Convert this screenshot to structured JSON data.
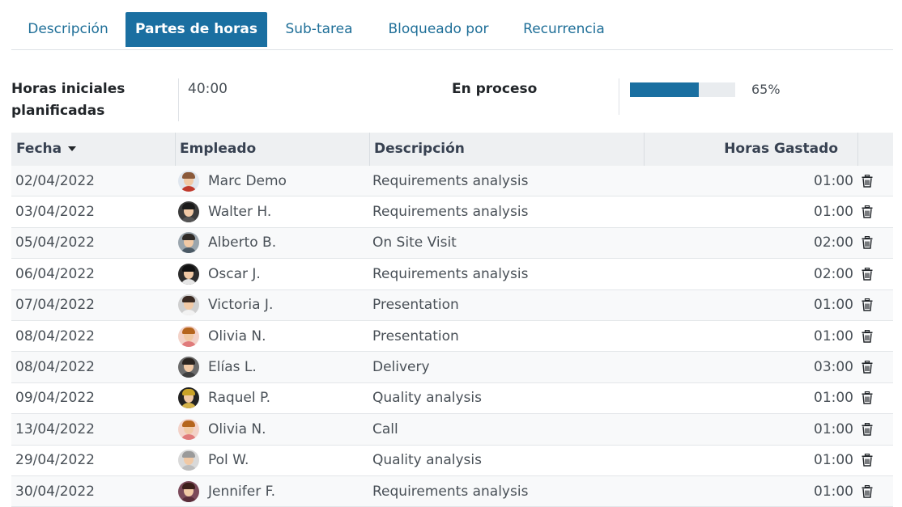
{
  "tabs": [
    {
      "label": "Descripción",
      "active": false
    },
    {
      "label": "Partes de horas",
      "active": true
    },
    {
      "label": "Sub-tarea",
      "active": false
    },
    {
      "label": "Bloqueado por",
      "active": false
    },
    {
      "label": "Recurrencia",
      "active": false
    }
  ],
  "summary": {
    "planned_label_line1": "Horas iniciales",
    "planned_label_line2": "planificadas",
    "planned_value": "40:00",
    "status_label": "En proceso",
    "progress_percent": 65,
    "progress_text": "65%"
  },
  "table": {
    "headers": {
      "date": "Fecha",
      "employee": "Empleado",
      "description": "Descripción",
      "hours": "Horas Gastado"
    },
    "rows": [
      {
        "date": "02/04/2022",
        "employee": "Marc Demo",
        "description": "Requirements analysis",
        "hours": "01:00",
        "avatar": {
          "bg": "#dfe6ee",
          "hair": "#8a5a3b",
          "body": "#c0392b"
        }
      },
      {
        "date": "03/04/2022",
        "employee": "Walter H.",
        "description": "Requirements analysis",
        "hours": "01:00",
        "avatar": {
          "bg": "#3b3b3b",
          "hair": "#1a1a1a",
          "body": "#555555"
        }
      },
      {
        "date": "05/04/2022",
        "employee": "Alberto B.",
        "description": "On Site Visit",
        "hours": "02:00",
        "avatar": {
          "bg": "#9aa5ad",
          "hair": "#2e2a26",
          "body": "#4b5a66"
        }
      },
      {
        "date": "06/04/2022",
        "employee": "Oscar J.",
        "description": "Requirements analysis",
        "hours": "02:00",
        "avatar": {
          "bg": "#2c2c2c",
          "hair": "#111111",
          "body": "#e6e6e6"
        }
      },
      {
        "date": "07/04/2022",
        "employee": "Victoria J.",
        "description": "Presentation",
        "hours": "01:00",
        "avatar": {
          "bg": "#cfcfcf",
          "hair": "#3a2a22",
          "body": "#f2f2f2"
        }
      },
      {
        "date": "08/04/2022",
        "employee": "Olivia N.",
        "description": "Presentation",
        "hours": "01:00",
        "avatar": {
          "bg": "#f3d2c8",
          "hair": "#b5651d",
          "body": "#e07b7b"
        }
      },
      {
        "date": "08/04/2022",
        "employee": "Elías L.",
        "description": "Delivery",
        "hours": "03:00",
        "avatar": {
          "bg": "#6b6b6b",
          "hair": "#2a2420",
          "body": "#3f3f3f"
        }
      },
      {
        "date": "09/04/2022",
        "employee": "Raquel P.",
        "description": "Quality analysis",
        "hours": "01:00",
        "avatar": {
          "bg": "#222222",
          "hair": "#c9a227",
          "body": "#d4b24a"
        }
      },
      {
        "date": "13/04/2022",
        "employee": "Olivia N.",
        "description": "Call",
        "hours": "01:00",
        "avatar": {
          "bg": "#f3d2c8",
          "hair": "#b5651d",
          "body": "#e07b7b"
        }
      },
      {
        "date": "29/04/2022",
        "employee": "Pol W.",
        "description": "Quality analysis",
        "hours": "01:00",
        "avatar": {
          "bg": "#d9d9d9",
          "hair": "#9a9a9a",
          "body": "#bdbdbd"
        }
      },
      {
        "date": "30/04/2022",
        "employee": "Jennifer F.",
        "description": "Requirements analysis",
        "hours": "01:00",
        "avatar": {
          "bg": "#7b4a5a",
          "hair": "#3b1f1a",
          "body": "#5a2d3a"
        }
      }
    ]
  }
}
